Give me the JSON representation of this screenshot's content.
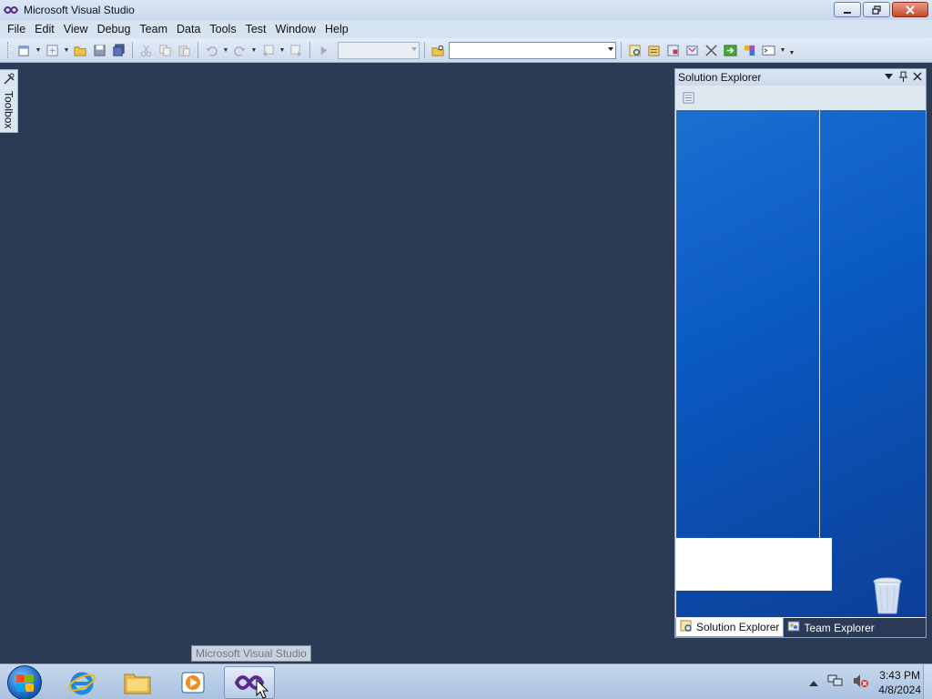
{
  "window": {
    "title": "Microsoft Visual Studio",
    "controls": {
      "minimize": "—",
      "restore": "❐",
      "close": "✕"
    }
  },
  "menu": [
    "File",
    "Edit",
    "View",
    "Debug",
    "Team",
    "Data",
    "Tools",
    "Test",
    "Window",
    "Help"
  ],
  "toolbar": {
    "config_combo_value": "",
    "find_combo_value": ""
  },
  "toolbox": {
    "label": "Toolbox"
  },
  "solution_explorer": {
    "title": "Solution Explorer",
    "tabs": [
      {
        "label": "Solution Explorer",
        "active": true
      },
      {
        "label": "Team Explorer",
        "active": false
      }
    ]
  },
  "taskbar": {
    "tooltip": "Microsoft Visual Studio",
    "time": "3:43 PM",
    "date": "4/8/2024"
  },
  "colors": {
    "workspace": "#2b3a55",
    "desktop_blue": "#0a5ac4",
    "close_red": "#c64a30"
  }
}
